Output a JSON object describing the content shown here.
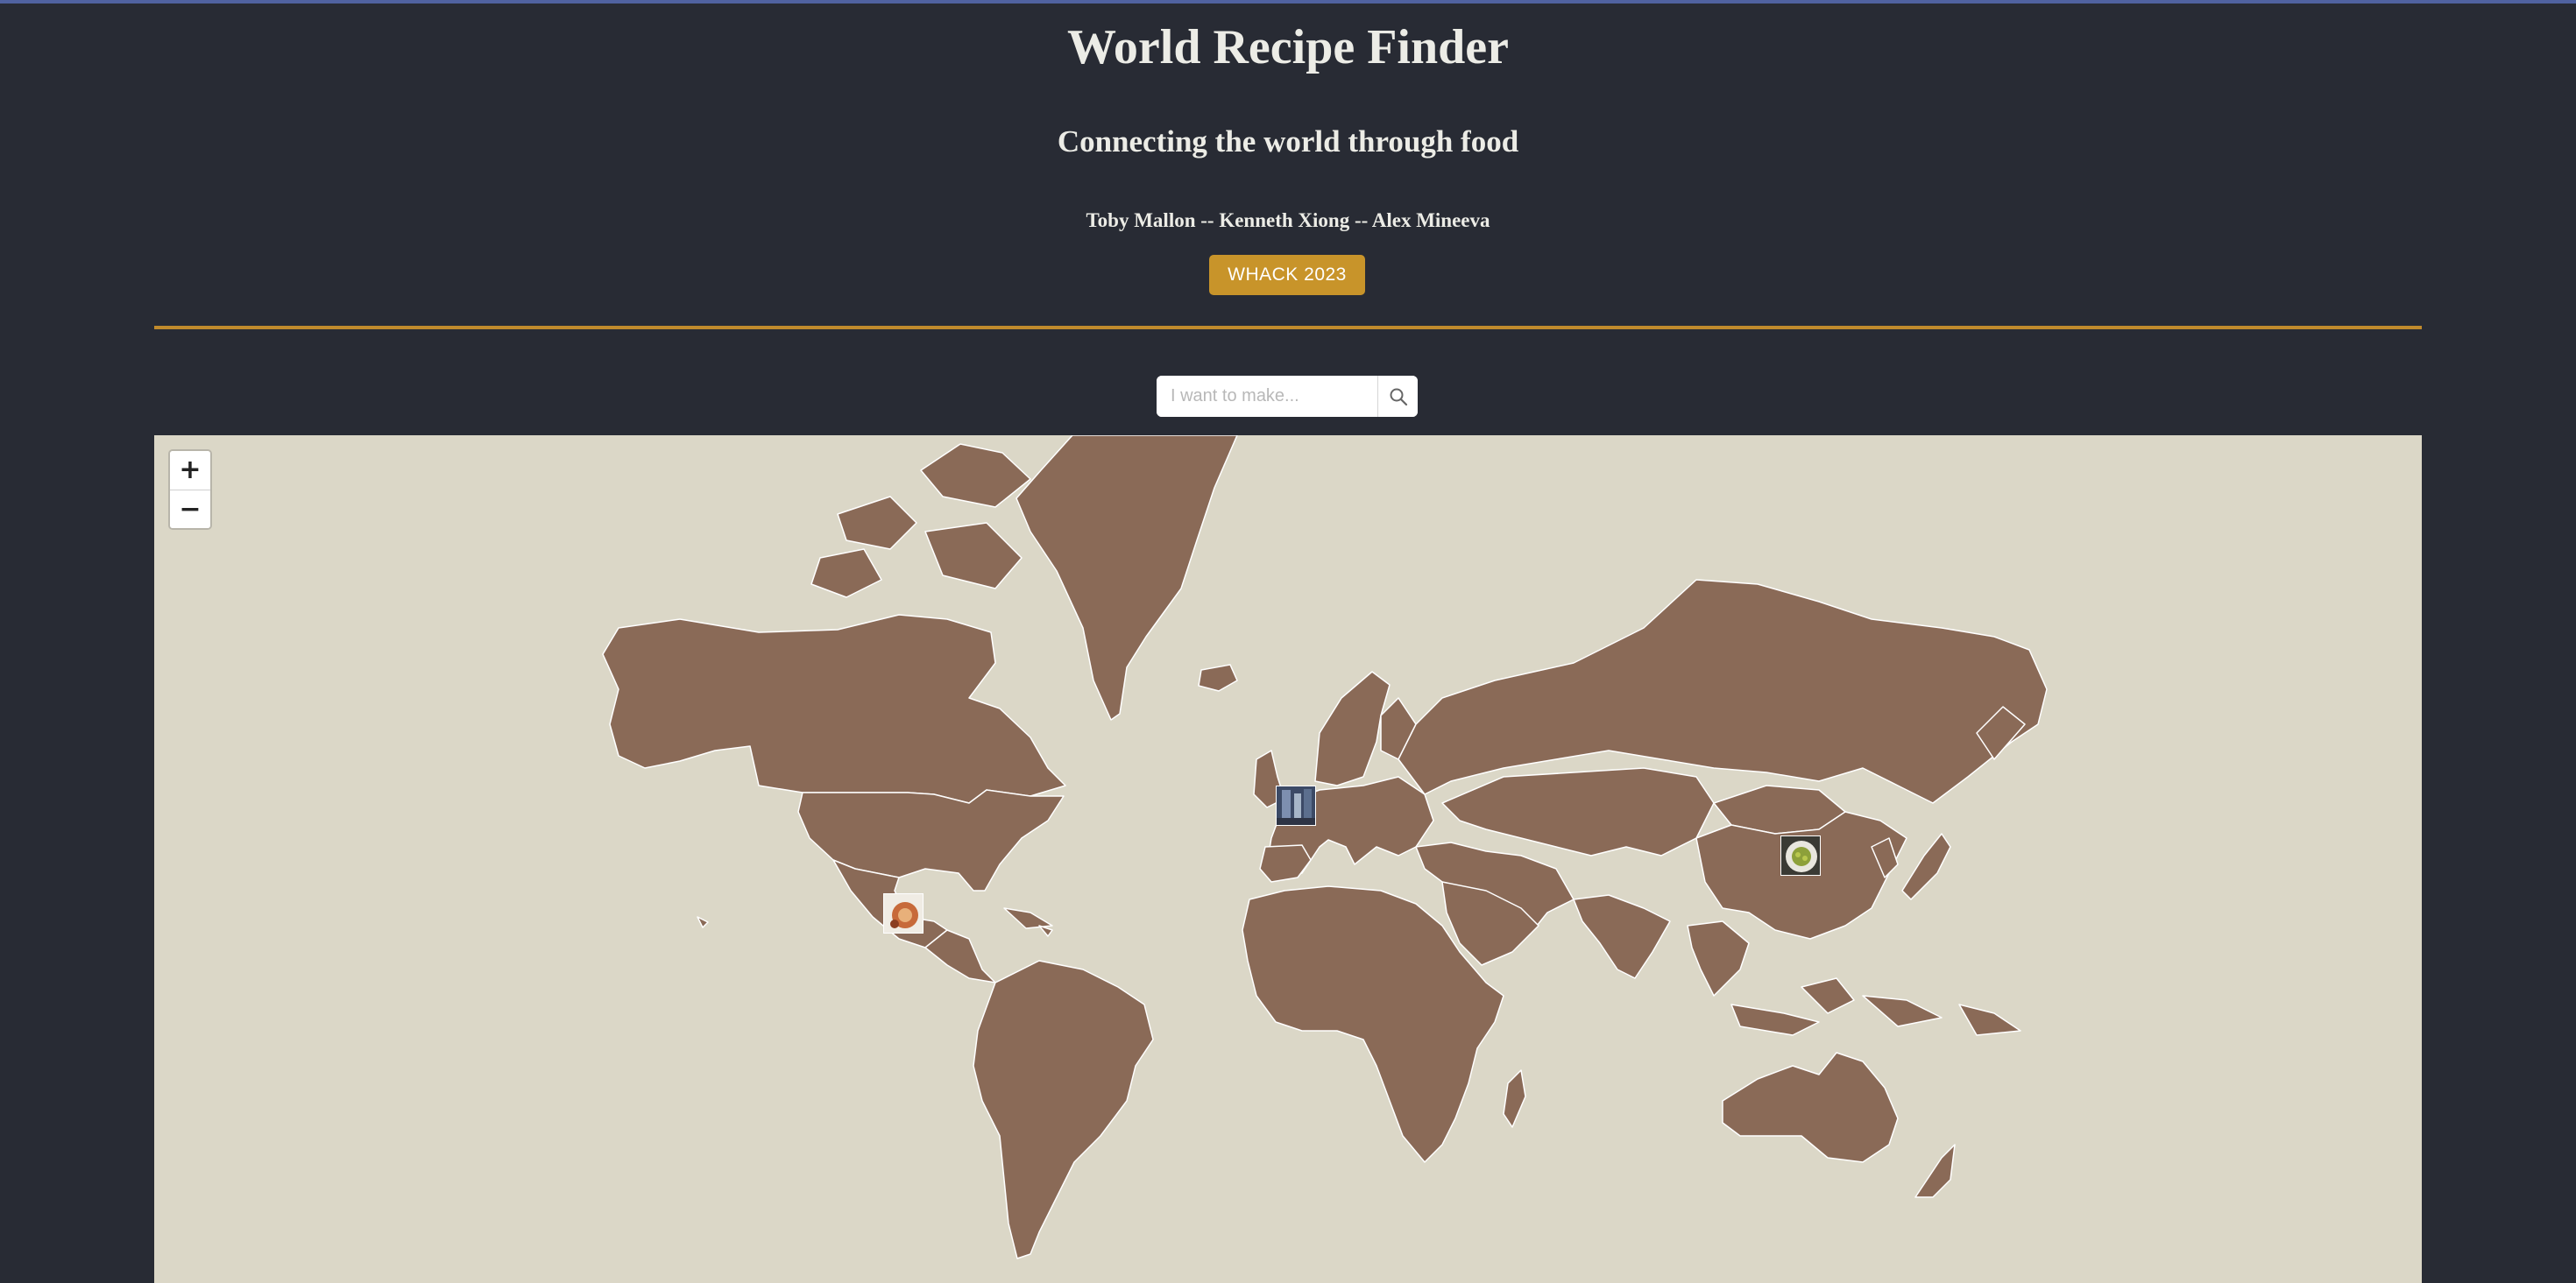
{
  "header": {
    "title": "World Recipe Finder",
    "subtitle": "Connecting the world through food",
    "authors": "Toby Mallon -- Kenneth Xiong -- Alex Mineeva",
    "badge": "WHACK 2023"
  },
  "search": {
    "placeholder": "I want to make...",
    "value": "",
    "icon": "search-icon"
  },
  "map": {
    "zoom_in": "+",
    "zoom_out": "−",
    "markers": [
      {
        "region": "Spain",
        "icon": "recipe-photo-icon"
      },
      {
        "region": "Mexico",
        "icon": "recipe-photo-icon"
      },
      {
        "region": "Japan",
        "icon": "recipe-photo-icon"
      }
    ]
  },
  "colors": {
    "background": "#282b34",
    "accent": "#c8942a",
    "ocean": "#dbd7c7",
    "land": "#8a6a57",
    "border": "#ffffff"
  }
}
